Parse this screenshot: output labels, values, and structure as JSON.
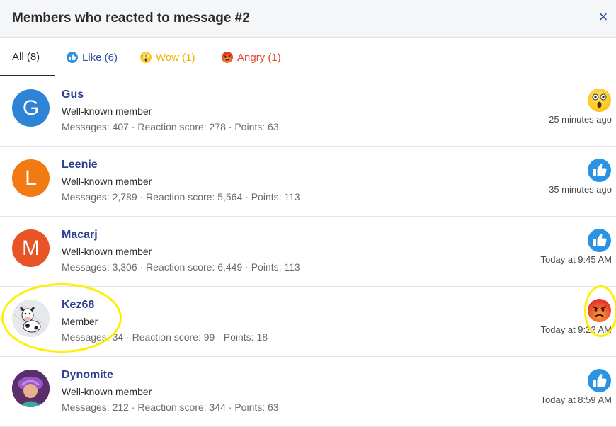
{
  "dialog": {
    "title": "Members who reacted to message #2",
    "close_label": "×"
  },
  "tabs": [
    {
      "label": "All (8)",
      "icon": "",
      "color": "#2b2b2b"
    },
    {
      "label": "Like (6)",
      "icon": "like-icon",
      "color": "#2e4e9a"
    },
    {
      "label": "Wow (1)",
      "icon": "wow-icon",
      "color": "#f0b400"
    },
    {
      "label": "Angry (1)",
      "icon": "angry-icon",
      "color": "#e0452e"
    }
  ],
  "members": [
    {
      "name": "Gus",
      "title": "Well-known member",
      "stats": "Messages: 407 · Reaction score: 278 · Points: 63",
      "time": "25 minutes ago",
      "reaction": "wow",
      "avatar_letter": "G",
      "avatar_color": "#2f83d6"
    },
    {
      "name": "Leenie",
      "title": "Well-known member",
      "stats": "Messages: 2,789 · Reaction score: 5,564 · Points: 113",
      "time": "35 minutes ago",
      "reaction": "like",
      "avatar_letter": "L",
      "avatar_color": "#f27a12"
    },
    {
      "name": "Macarj",
      "title": "Well-known member",
      "stats": "Messages: 3,306 · Reaction score: 6,449 · Points: 113",
      "time": "Today at 9:45 AM",
      "reaction": "like",
      "avatar_letter": "M",
      "avatar_color": "#e75526"
    },
    {
      "name": "Kez68",
      "title": "Member",
      "stats": "Messages: 34 · Reaction score: 99 · Points: 18",
      "time": "Today at 9:22 AM",
      "reaction": "angry",
      "avatar_letter": "",
      "avatar_color": "#e9ecef"
    },
    {
      "name": "Dynomite",
      "title": "Well-known member",
      "stats": "Messages: 212 · Reaction score: 344 · Points: 63",
      "time": "Today at 8:59 AM",
      "reaction": "like",
      "avatar_letter": "",
      "avatar_color": "#7a3b8f"
    }
  ]
}
